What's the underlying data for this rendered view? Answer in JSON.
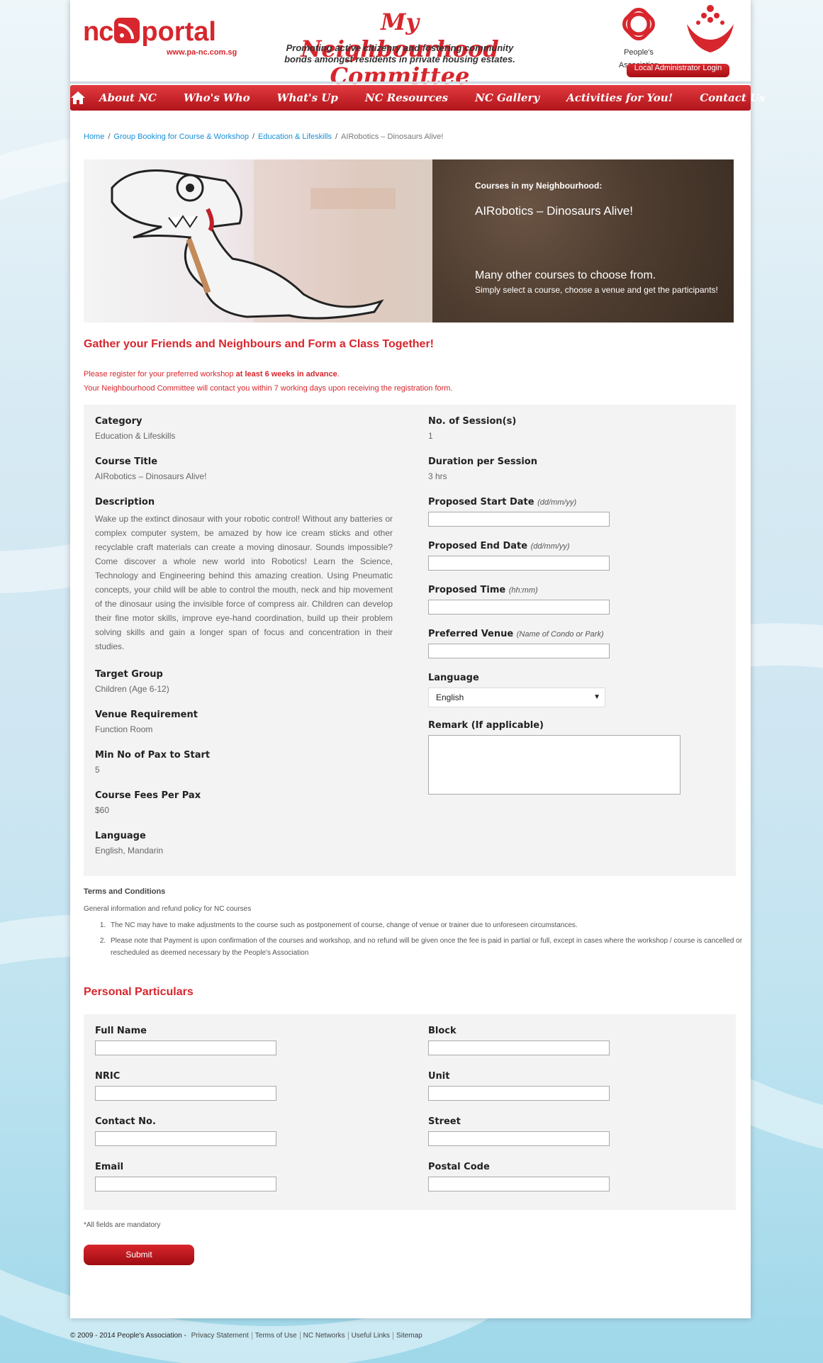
{
  "header": {
    "logo_nc": "nc",
    "logo_portal": "portal",
    "logo_url": "www.pa-nc.com.sg",
    "site_title": "My Neighbourhood Committee",
    "tagline": "Promoting active citizenry and fostering community bonds amongst residents in private housing estates.",
    "pa_label": "People's Association",
    "admin_login": "Local Administrator Login"
  },
  "nav": {
    "items": [
      "About NC",
      "Who's Who",
      "What's Up",
      "NC Resources",
      "NC Gallery",
      "Activities for You!",
      "Contact Us"
    ]
  },
  "breadcrumb": [
    "Home",
    "Group Booking for Course & Workshop",
    "Education & Lifeskills",
    "AIRobotics – Dinosaurs Alive!"
  ],
  "banner": {
    "kicker": "Courses in my Neighbourhood:",
    "title": "AIRobotics – Dinosaurs Alive!",
    "line1": "Many other courses to choose from.",
    "line2": "Simply select a course, choose a venue and get the participants!"
  },
  "intro": {
    "heading": "Gather your Friends and Neighbours and Form a Class Together!",
    "note1_a": "Please register for your preferred workshop ",
    "note1_b": "at least 6 weeks in advance",
    "note1_c": ".",
    "note2": "Your Neighbourhood Committee will contact you within 7 working days upon receiving the registration form."
  },
  "course": {
    "category_label": "Category",
    "category": "Education & Lifeskills",
    "title_label": "Course Title",
    "title": "AIRobotics – Dinosaurs Alive!",
    "description_label": "Description",
    "description": "Wake up the extinct dinosaur with your robotic control! Without any batteries or complex computer system, be amazed by how ice cream sticks and other recyclable craft materials can create a moving dinosaur. Sounds impossible? Come discover a whole new world into Robotics! Learn the Science, Technology and Engineering behind this amazing creation. Using Pneumatic concepts, your child will be able to control the mouth, neck and hip movement of the dinosaur using the invisible force of compress air. Children can develop their fine motor skills, improve eye-hand coordination, build up their problem solving skills and gain a longer span of focus and concentration in their studies.",
    "target_label": "Target Group",
    "target": "Children (Age 6-12)",
    "venue_req_label": "Venue Requirement",
    "venue_req": "Function Room",
    "min_pax_label": "Min No of Pax to Start",
    "min_pax": "5",
    "fees_label": "Course Fees Per Pax",
    "fees": "$60",
    "language_label": "Language",
    "language": "English, Mandarin",
    "sessions_label": "No. of Session(s)",
    "sessions": "1",
    "duration_label": "Duration per Session",
    "duration": "3 hrs",
    "start_label": "Proposed Start Date",
    "start_hint": "(dd/mm/yy)",
    "end_label": "Proposed End Date",
    "end_hint": "(dd/mm/yy)",
    "time_label": "Proposed Time",
    "time_hint": "(hh:mm)",
    "venue_label": "Preferred Venue",
    "venue_hint": "(Name of Condo or Park)",
    "lang_select_label": "Language",
    "lang_select_value": "English",
    "remark_label": "Remark (If applicable)"
  },
  "terms": {
    "heading": "Terms and Conditions",
    "sub": "General information and refund policy for NC courses",
    "items": [
      "The NC may have to make adjustments to the course such as postponement of course, change of venue or trainer due to unforeseen circumstances.",
      "Please note that Payment is upon confirmation of the courses and workshop, and no refund will be given once the fee is paid in partial or full, except in cases where the workshop / course is cancelled or rescheduled as deemed necessary by the People's Association"
    ]
  },
  "personal": {
    "heading": "Personal Particulars",
    "full_name": "Full Name",
    "nric": "NRIC",
    "contact": "Contact No.",
    "email": "Email",
    "block": "Block",
    "unit": "Unit",
    "street": "Street",
    "postal": "Postal Code"
  },
  "mandatory": "*All fields are mandatory",
  "submit": "Submit",
  "footer": {
    "copyright": "© 2009 - 2014 People's Association -",
    "links": [
      "Privacy Statement",
      "Terms of Use",
      "NC Networks",
      "Useful Links",
      "Sitemap"
    ]
  },
  "colors": {
    "brand_red": "#d7262d",
    "link_blue": "#1a8fd6",
    "panel_brown": "#4d3c2f"
  },
  "icons": {
    "home": "home-icon",
    "rss": "rss-icon",
    "select_arrow": "chevron-down-icon"
  }
}
